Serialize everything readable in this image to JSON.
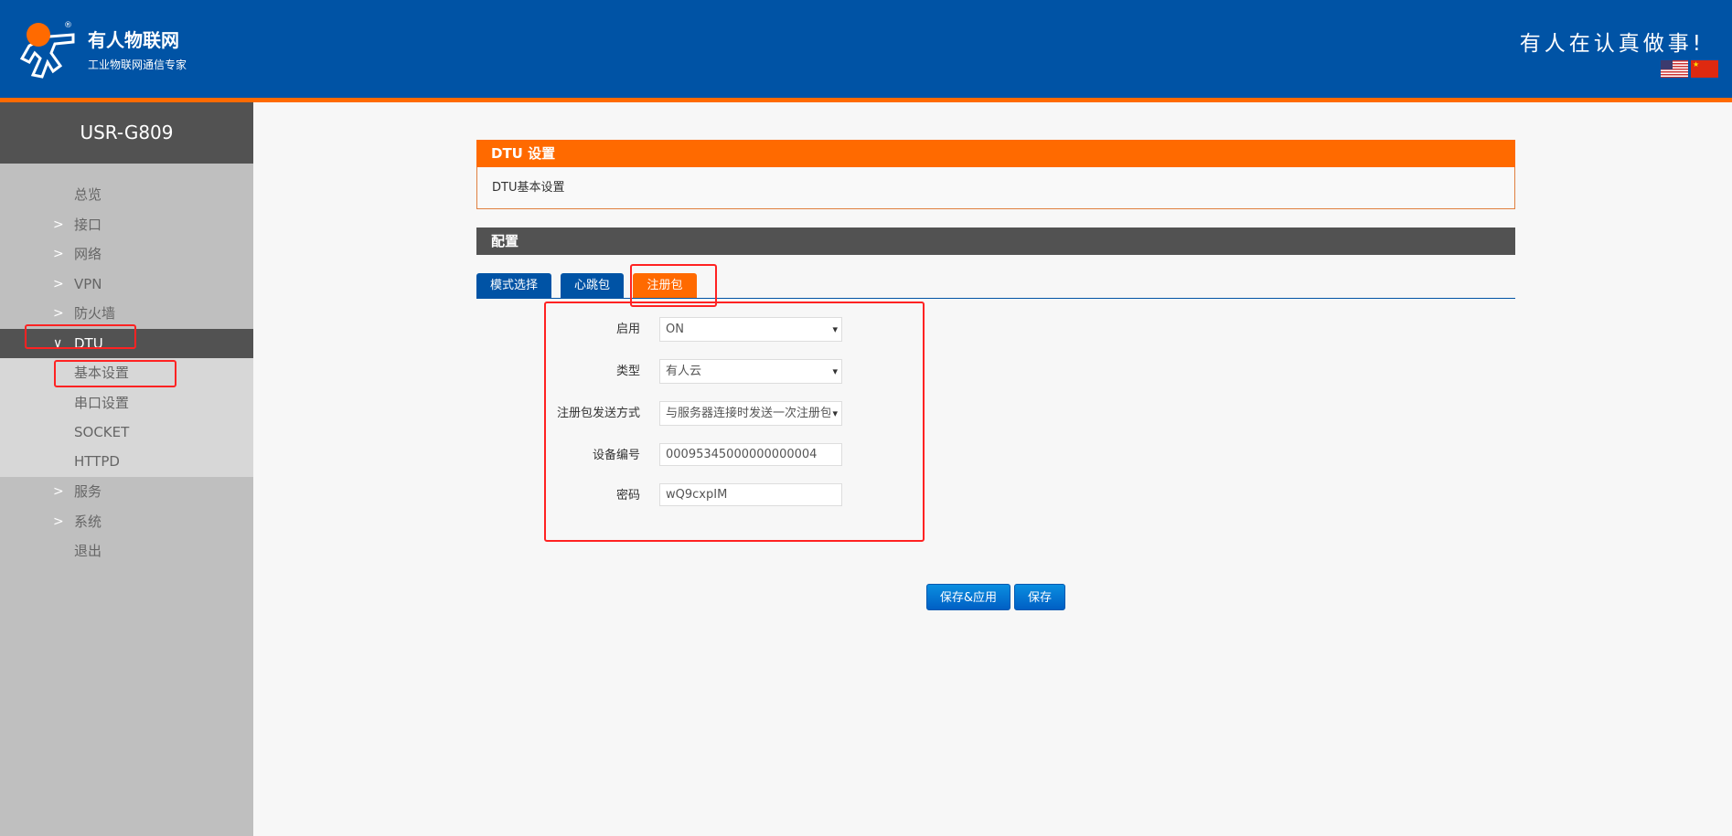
{
  "header": {
    "brand": "有人物联网",
    "subtitle": "工业物联网通信专家",
    "slogan": "有人在认真做事!",
    "flags": [
      "us-flag-icon",
      "cn-flag-icon"
    ]
  },
  "sidebar": {
    "title": "USR-G809",
    "items": [
      {
        "label": "总览",
        "expandable": false
      },
      {
        "label": "接口",
        "expandable": true
      },
      {
        "label": "网络",
        "expandable": true
      },
      {
        "label": "VPN",
        "expandable": true
      },
      {
        "label": "防火墙",
        "expandable": true
      },
      {
        "label": "DTU",
        "expandable": true,
        "expanded": true
      },
      {
        "label": "基本设置"
      },
      {
        "label": "串口设置"
      },
      {
        "label": "SOCKET"
      },
      {
        "label": "HTTPD"
      },
      {
        "label": "服务",
        "expandable": true
      },
      {
        "label": "系统",
        "expandable": true
      },
      {
        "label": "退出",
        "expandable": false
      }
    ]
  },
  "panel": {
    "title": "DTU 设置",
    "description": "DTU基本设置"
  },
  "config": {
    "title": "配置",
    "tabs": [
      {
        "label": "模式选择"
      },
      {
        "label": "心跳包"
      },
      {
        "label": "注册包",
        "active": true
      }
    ]
  },
  "form": {
    "enable": {
      "label": "启用",
      "value": "ON"
    },
    "type": {
      "label": "类型",
      "value": "有人云"
    },
    "send_mode": {
      "label": "注册包发送方式",
      "value": "与服务器连接时发送一次注册包"
    },
    "device_id": {
      "label": "设备编号",
      "value": "00095345000000000004"
    },
    "password": {
      "label": "密码",
      "value": "wQ9cxpIM"
    }
  },
  "buttons": {
    "save_apply": "保存&应用",
    "save": "保存"
  },
  "colors": {
    "header": "#0053a5",
    "accent": "#ff6a00",
    "dark": "#525252",
    "annotation": "#ff2222"
  }
}
